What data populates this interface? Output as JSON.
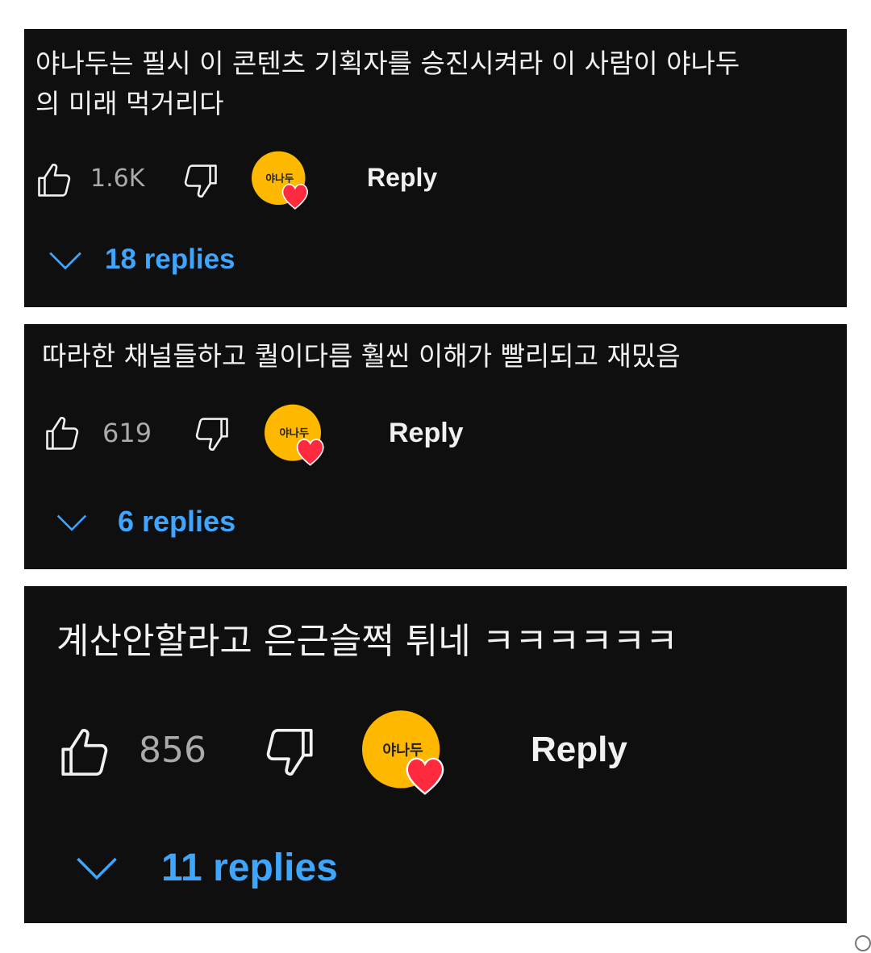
{
  "comments": [
    {
      "text": "야나두는 필시 이 콘텐츠 기획자를 승진시켜라 이 사람이 야나두\n의 미래 먹거리다",
      "likes": "1.6K",
      "reply_label": "Reply",
      "replies_label": "18 replies",
      "avatar_text": "야나두"
    },
    {
      "text": "따라한 채널들하고 퀄이다름 훨씬 이해가 빨리되고 재밌음",
      "likes": "619",
      "reply_label": "Reply",
      "replies_label": "6 replies",
      "avatar_text": "야나두"
    },
    {
      "text": "계산안할라고 은근슬쩍 튀네 ㅋㅋㅋㅋㅋㅋ",
      "likes": "856",
      "reply_label": "Reply",
      "replies_label": "11 replies",
      "avatar_text": "야나두"
    }
  ],
  "colors": {
    "background": "#0f0f0f",
    "text": "#f1f1f1",
    "count": "#aaaaaa",
    "link": "#3ea6ff",
    "avatar": "#ffb800",
    "heart": "#ff2a3d"
  },
  "icons": [
    "thumbs-up-icon",
    "thumbs-down-icon",
    "creator-heart-avatar",
    "chevron-down-icon"
  ]
}
